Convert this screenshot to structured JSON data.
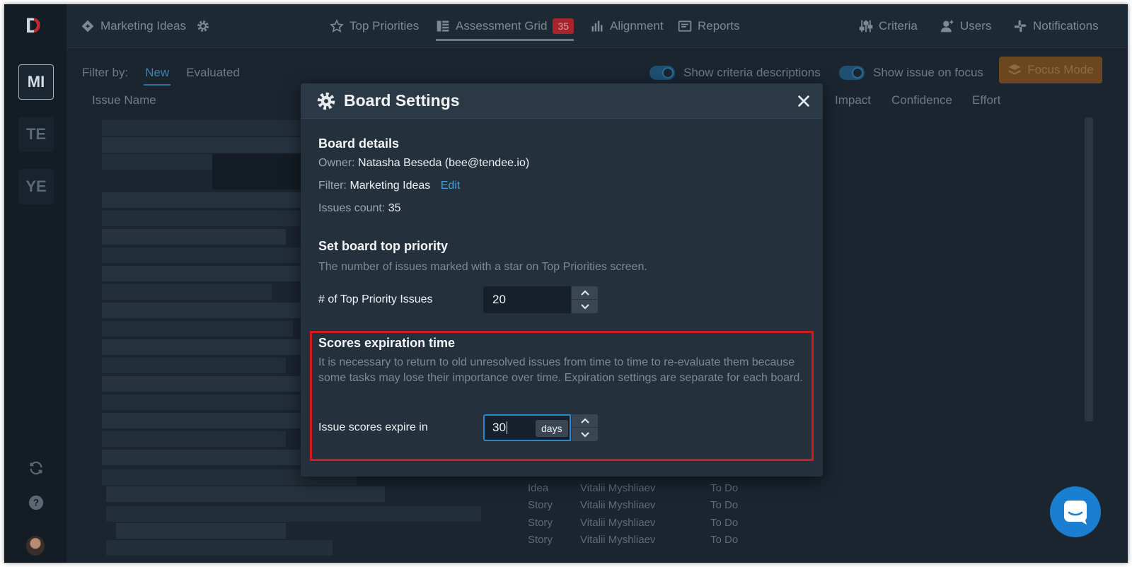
{
  "app": {
    "logo_letter": "D"
  },
  "boards": [
    "MI",
    "TE",
    "YE"
  ],
  "topbar": {
    "board_name": "Marketing Ideas",
    "nav": [
      {
        "label": "Top Priorities",
        "icon": "star-icon"
      },
      {
        "label": "Assessment Grid",
        "icon": "grid-list-icon",
        "badge": "35",
        "active": true
      },
      {
        "label": "Alignment",
        "icon": "bar-chart-icon"
      },
      {
        "label": "Reports",
        "icon": "report-icon"
      }
    ],
    "right": [
      {
        "label": "Criteria",
        "icon": "sliders-icon"
      },
      {
        "label": "Users",
        "icon": "add-user-icon"
      },
      {
        "label": "Notifications",
        "icon": "slack-icon"
      }
    ]
  },
  "filter": {
    "label": "Filter by:",
    "options": [
      "New",
      "Evaluated"
    ],
    "active": "New"
  },
  "toggles": [
    "Show criteria descriptions",
    "Show issue on focus"
  ],
  "focus_mode": "Focus Mode",
  "columns": {
    "issue_name": "Issue Name",
    "impact": "Impact",
    "confidence": "Confidence",
    "effort": "Effort"
  },
  "visible_rows": [
    {
      "type": "Idea",
      "assignee": "Vitalii Myshliaev",
      "status": "To Do"
    },
    {
      "type": "Story",
      "assignee": "Vitalii Myshliaev",
      "status": "To Do"
    },
    {
      "type": "Story",
      "assignee": "Vitalii Myshliaev",
      "status": "To Do"
    },
    {
      "type": "Story",
      "assignee": "Vitalii Myshliaev",
      "status": "To Do"
    }
  ],
  "modal": {
    "title": "Board Settings",
    "details": {
      "heading": "Board details",
      "owner_label": "Owner:",
      "owner_value": "Natasha Beseda (bee@tendee.io)",
      "filter_label": "Filter:",
      "filter_value": "Marketing Ideas",
      "edit_label": "Edit",
      "count_label": "Issues count:",
      "count_value": "35"
    },
    "top_priority": {
      "heading": "Set board top priority",
      "description": "The number of issues marked with a star on Top Priorities screen.",
      "field_label": "# of Top Priority Issues",
      "value": "20"
    },
    "expiration": {
      "heading": "Scores expiration time",
      "description": "It is necessary to return to old unresolved issues from time to time to re-evaluate them because some tasks may lose their importance over time. Expiration settings are separate for each board.",
      "field_label": "Issue scores expire in",
      "value": "30",
      "unit": "days"
    }
  },
  "colors": {
    "accent": "#2e86c8",
    "highlight": "#d11a1f",
    "badge": "#a8232a",
    "focus": "#6b4720"
  }
}
